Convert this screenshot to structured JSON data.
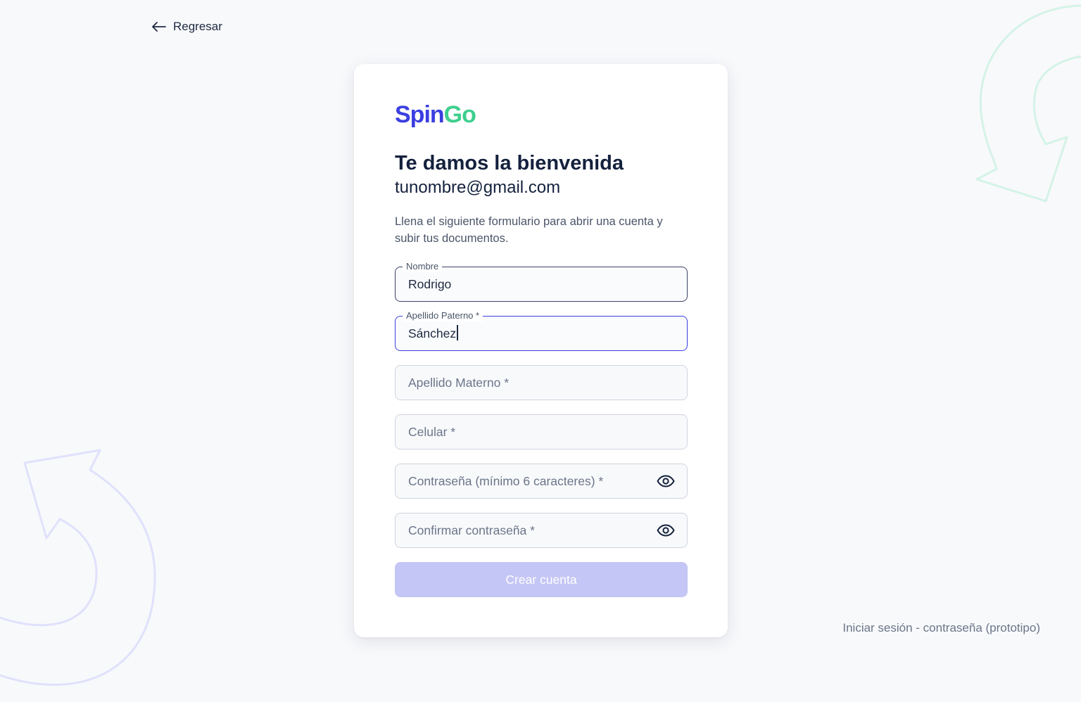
{
  "nav": {
    "back_label": "Regresar"
  },
  "brand": {
    "part1": "Spin",
    "part2": "Go",
    "color_primary": "#3b3fe0",
    "color_secondary": "#3ecf8e"
  },
  "header": {
    "title": "Te damos la bienvenida",
    "email": "tunombre@gmail.com",
    "description": "Llena el siguiente formulario para abrir una cuenta y subir tus documentos."
  },
  "form": {
    "nombre": {
      "label": "Nombre",
      "value": "Rodrigo"
    },
    "apellido_paterno": {
      "label": "Apellido Paterno *",
      "value": "Sánchez"
    },
    "apellido_materno": {
      "placeholder": "Apellido Materno *"
    },
    "celular": {
      "placeholder": "Celular *"
    },
    "password": {
      "placeholder": "Contraseña (mínimo 6 caracteres) *",
      "icon": "eye-icon"
    },
    "confirm_password": {
      "placeholder": "Confirmar contraseña *",
      "icon": "eye-icon"
    },
    "submit_label": "Crear cuenta"
  },
  "footer_note": "Iniciar sesión - contraseña (prototipo)"
}
